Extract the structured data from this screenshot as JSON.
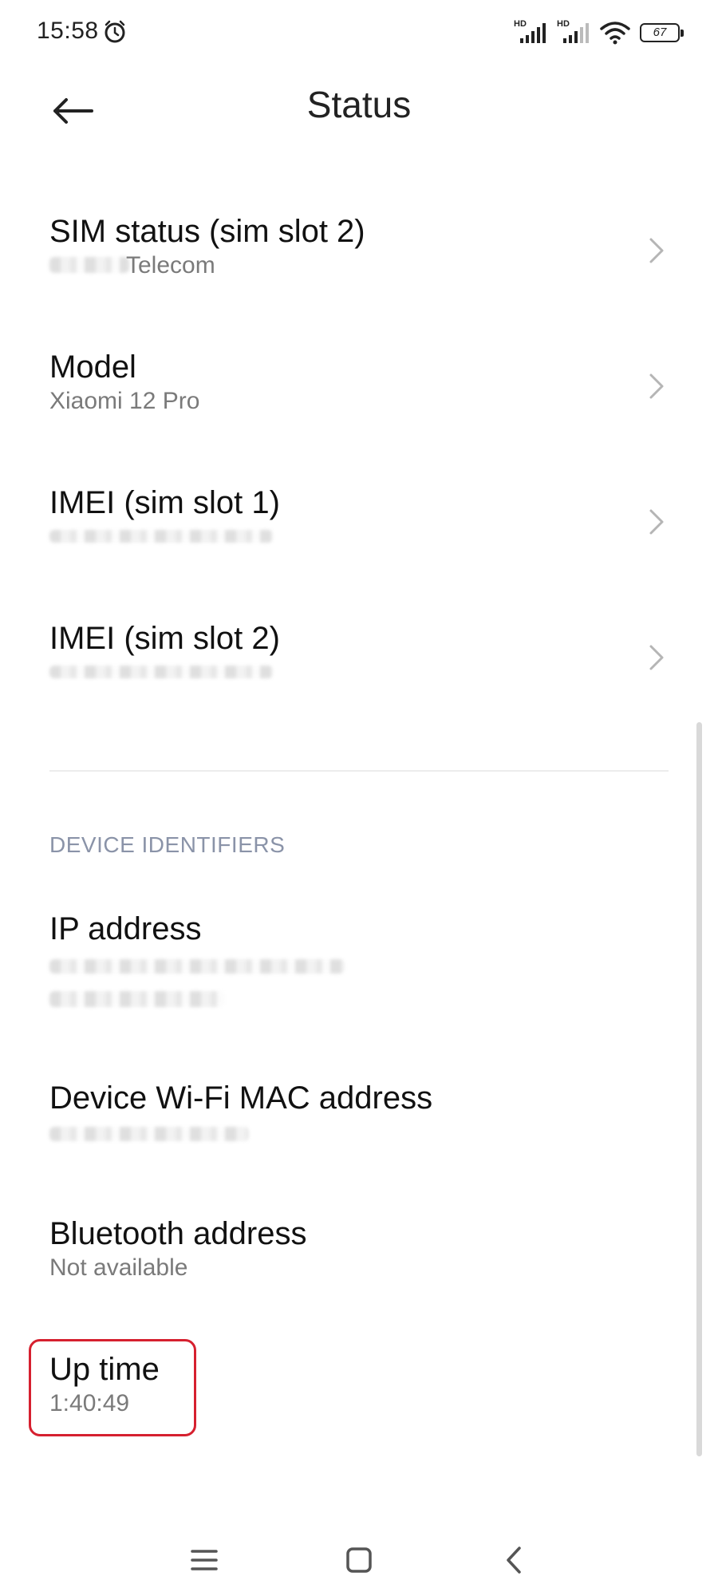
{
  "status_bar": {
    "time": "15:58",
    "battery": "67",
    "icons": [
      "alarm-icon",
      "hd-signal-icon",
      "hd-signal-icon",
      "wifi-icon",
      "battery-icon"
    ],
    "hd_label": "HD"
  },
  "header": {
    "title": "Status",
    "back_icon": "arrow-left-icon"
  },
  "items": [
    {
      "title": "SIM status (sim slot 2)",
      "subtitle": "Telecom",
      "subtitle_partially_obscured": true,
      "has_chevron": true
    },
    {
      "title": "Model",
      "subtitle": "Xiaomi 12 Pro",
      "has_chevron": true
    },
    {
      "title": "IMEI (sim slot 1)",
      "subtitle": "",
      "subtitle_obscured": true,
      "has_chevron": true
    },
    {
      "title": "IMEI (sim slot 2)",
      "subtitle": "",
      "subtitle_obscured": true,
      "has_chevron": true
    }
  ],
  "section": {
    "header": "DEVICE IDENTIFIERS",
    "items": [
      {
        "title": "IP address",
        "subtitle": "",
        "subtitle_obscured": true
      },
      {
        "title": "Device Wi-Fi MAC address",
        "subtitle": "",
        "subtitle_obscured": true
      },
      {
        "title": "Bluetooth address",
        "subtitle": "Not available"
      },
      {
        "title": "Up time",
        "subtitle": "1:40:49",
        "highlighted": true
      }
    ]
  },
  "colors": {
    "highlight": "#d6202f",
    "section_header": "#8a93a8",
    "subtitle": "#7a7a7a"
  },
  "nav_bar": {
    "icons": [
      "menu-icon",
      "home-icon",
      "back-icon"
    ]
  }
}
